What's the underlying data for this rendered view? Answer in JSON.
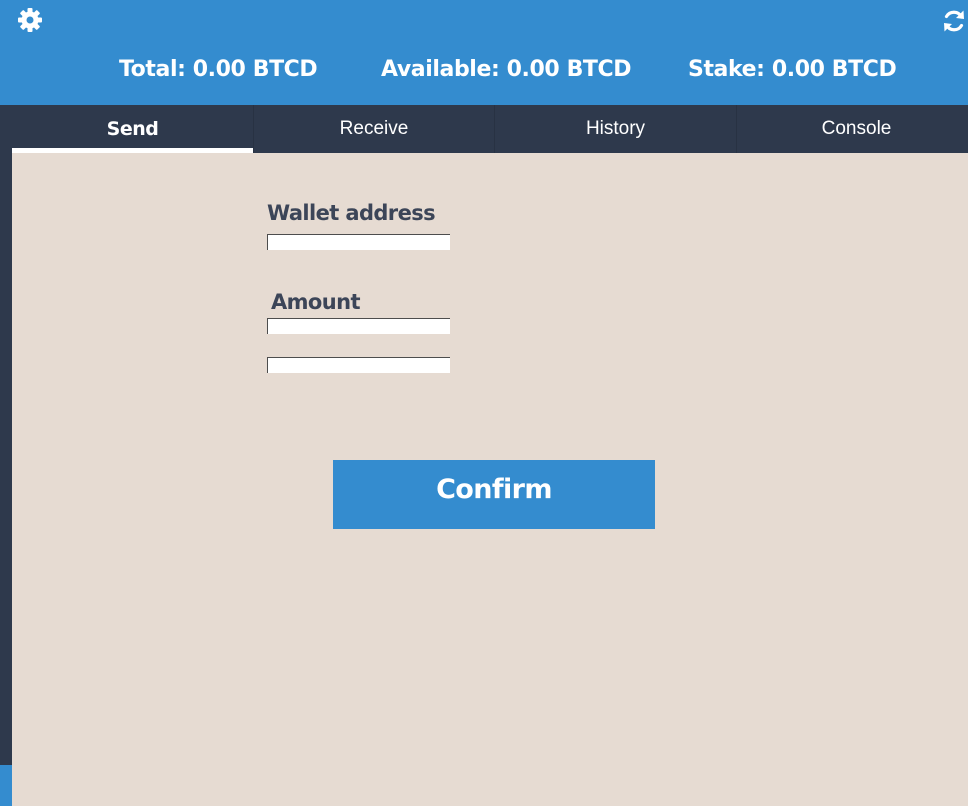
{
  "header": {
    "settings_icon": "gear-icon",
    "refresh_icon": "refresh-icon",
    "total": "Total: 0.00 BTCD",
    "available": "Available: 0.00 BTCD",
    "stake": "Stake: 0.00 BTCD"
  },
  "tabs": [
    {
      "label": "Send",
      "active": true
    },
    {
      "label": "Receive",
      "active": false
    },
    {
      "label": "History",
      "active": false
    },
    {
      "label": "Console",
      "active": false
    }
  ],
  "form": {
    "wallet_label": "Wallet address",
    "wallet_value": "",
    "amount_label": "Amount",
    "amount_value": "",
    "extra_value": "",
    "confirm_label": "Confirm"
  },
  "colors": {
    "accent": "#348ccf",
    "nav": "#2e394c",
    "background": "#e6dbd2",
    "label_text": "#3c4558"
  }
}
